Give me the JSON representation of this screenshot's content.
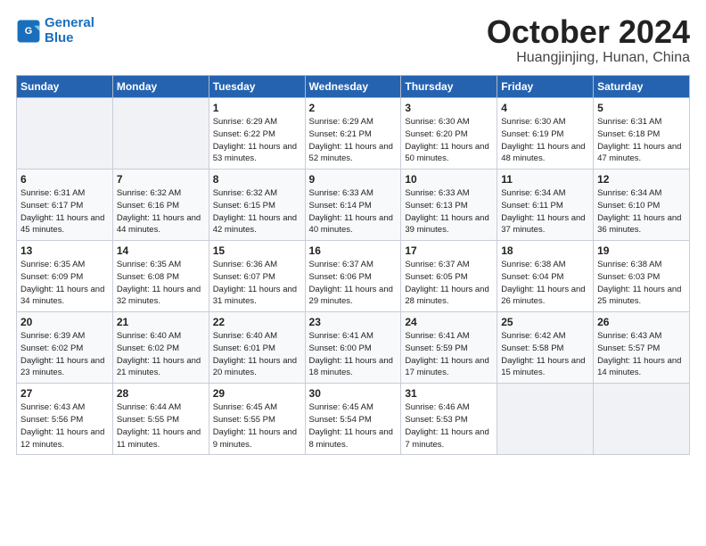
{
  "logo": {
    "line1": "General",
    "line2": "Blue"
  },
  "title": "October 2024",
  "subtitle": "Huangjinjing, Hunan, China",
  "headers": [
    "Sunday",
    "Monday",
    "Tuesday",
    "Wednesday",
    "Thursday",
    "Friday",
    "Saturday"
  ],
  "weeks": [
    [
      {
        "day": "",
        "info": ""
      },
      {
        "day": "",
        "info": ""
      },
      {
        "day": "1",
        "info": "Sunrise: 6:29 AM\nSunset: 6:22 PM\nDaylight: 11 hours and 53 minutes."
      },
      {
        "day": "2",
        "info": "Sunrise: 6:29 AM\nSunset: 6:21 PM\nDaylight: 11 hours and 52 minutes."
      },
      {
        "day": "3",
        "info": "Sunrise: 6:30 AM\nSunset: 6:20 PM\nDaylight: 11 hours and 50 minutes."
      },
      {
        "day": "4",
        "info": "Sunrise: 6:30 AM\nSunset: 6:19 PM\nDaylight: 11 hours and 48 minutes."
      },
      {
        "day": "5",
        "info": "Sunrise: 6:31 AM\nSunset: 6:18 PM\nDaylight: 11 hours and 47 minutes."
      }
    ],
    [
      {
        "day": "6",
        "info": "Sunrise: 6:31 AM\nSunset: 6:17 PM\nDaylight: 11 hours and 45 minutes."
      },
      {
        "day": "7",
        "info": "Sunrise: 6:32 AM\nSunset: 6:16 PM\nDaylight: 11 hours and 44 minutes."
      },
      {
        "day": "8",
        "info": "Sunrise: 6:32 AM\nSunset: 6:15 PM\nDaylight: 11 hours and 42 minutes."
      },
      {
        "day": "9",
        "info": "Sunrise: 6:33 AM\nSunset: 6:14 PM\nDaylight: 11 hours and 40 minutes."
      },
      {
        "day": "10",
        "info": "Sunrise: 6:33 AM\nSunset: 6:13 PM\nDaylight: 11 hours and 39 minutes."
      },
      {
        "day": "11",
        "info": "Sunrise: 6:34 AM\nSunset: 6:11 PM\nDaylight: 11 hours and 37 minutes."
      },
      {
        "day": "12",
        "info": "Sunrise: 6:34 AM\nSunset: 6:10 PM\nDaylight: 11 hours and 36 minutes."
      }
    ],
    [
      {
        "day": "13",
        "info": "Sunrise: 6:35 AM\nSunset: 6:09 PM\nDaylight: 11 hours and 34 minutes."
      },
      {
        "day": "14",
        "info": "Sunrise: 6:35 AM\nSunset: 6:08 PM\nDaylight: 11 hours and 32 minutes."
      },
      {
        "day": "15",
        "info": "Sunrise: 6:36 AM\nSunset: 6:07 PM\nDaylight: 11 hours and 31 minutes."
      },
      {
        "day": "16",
        "info": "Sunrise: 6:37 AM\nSunset: 6:06 PM\nDaylight: 11 hours and 29 minutes."
      },
      {
        "day": "17",
        "info": "Sunrise: 6:37 AM\nSunset: 6:05 PM\nDaylight: 11 hours and 28 minutes."
      },
      {
        "day": "18",
        "info": "Sunrise: 6:38 AM\nSunset: 6:04 PM\nDaylight: 11 hours and 26 minutes."
      },
      {
        "day": "19",
        "info": "Sunrise: 6:38 AM\nSunset: 6:03 PM\nDaylight: 11 hours and 25 minutes."
      }
    ],
    [
      {
        "day": "20",
        "info": "Sunrise: 6:39 AM\nSunset: 6:02 PM\nDaylight: 11 hours and 23 minutes."
      },
      {
        "day": "21",
        "info": "Sunrise: 6:40 AM\nSunset: 6:02 PM\nDaylight: 11 hours and 21 minutes."
      },
      {
        "day": "22",
        "info": "Sunrise: 6:40 AM\nSunset: 6:01 PM\nDaylight: 11 hours and 20 minutes."
      },
      {
        "day": "23",
        "info": "Sunrise: 6:41 AM\nSunset: 6:00 PM\nDaylight: 11 hours and 18 minutes."
      },
      {
        "day": "24",
        "info": "Sunrise: 6:41 AM\nSunset: 5:59 PM\nDaylight: 11 hours and 17 minutes."
      },
      {
        "day": "25",
        "info": "Sunrise: 6:42 AM\nSunset: 5:58 PM\nDaylight: 11 hours and 15 minutes."
      },
      {
        "day": "26",
        "info": "Sunrise: 6:43 AM\nSunset: 5:57 PM\nDaylight: 11 hours and 14 minutes."
      }
    ],
    [
      {
        "day": "27",
        "info": "Sunrise: 6:43 AM\nSunset: 5:56 PM\nDaylight: 11 hours and 12 minutes."
      },
      {
        "day": "28",
        "info": "Sunrise: 6:44 AM\nSunset: 5:55 PM\nDaylight: 11 hours and 11 minutes."
      },
      {
        "day": "29",
        "info": "Sunrise: 6:45 AM\nSunset: 5:55 PM\nDaylight: 11 hours and 9 minutes."
      },
      {
        "day": "30",
        "info": "Sunrise: 6:45 AM\nSunset: 5:54 PM\nDaylight: 11 hours and 8 minutes."
      },
      {
        "day": "31",
        "info": "Sunrise: 6:46 AM\nSunset: 5:53 PM\nDaylight: 11 hours and 7 minutes."
      },
      {
        "day": "",
        "info": ""
      },
      {
        "day": "",
        "info": ""
      }
    ]
  ]
}
